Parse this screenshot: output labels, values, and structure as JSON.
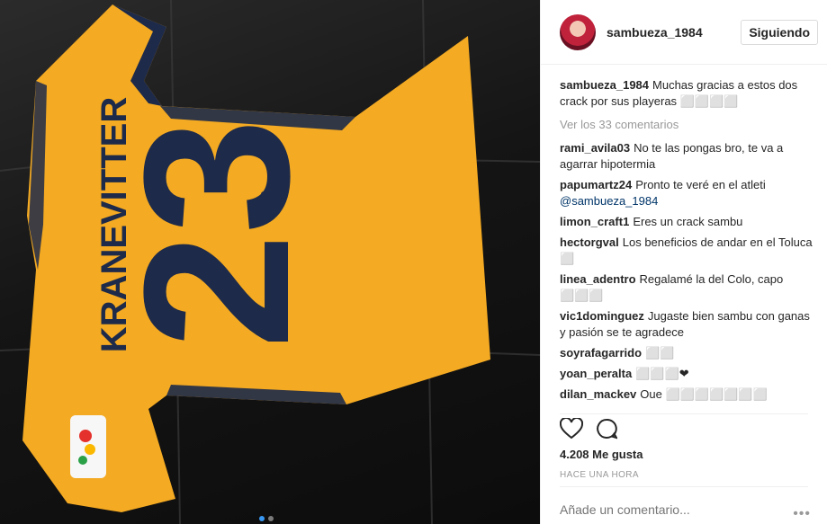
{
  "photo": {
    "jersey_name": "KRANEVITTER",
    "jersey_number": "23",
    "jersey_color": "#f4aa22",
    "trim_color": "#1d2a4a",
    "carousel_dots": 2,
    "carousel_active": 0
  },
  "header": {
    "username": "sambueza_1984",
    "follow_label": "Siguiendo"
  },
  "caption": {
    "user": "sambueza_1984",
    "text": "Muchas gracias a estos dos crack por sus playeras ⬜⬜⬜⬜"
  },
  "view_all_label": "Ver los 33 comentarios",
  "comments": [
    {
      "user": "rami_avila03",
      "text": "No te las pongas bro, te va a agarrar hipotermia"
    },
    {
      "user": "papumartz24",
      "text": "Pronto te veré en el atleti",
      "mention": "@sambueza_1984"
    },
    {
      "user": "limon_craft1",
      "text": "Eres un crack sambu"
    },
    {
      "user": "hectorgval",
      "text": "Los beneficios de andar en el Toluca ⬜"
    },
    {
      "user": "linea_adentro",
      "text": "Regalamé la del Colo, capo ⬜⬜⬜"
    },
    {
      "user": "vic1dominguez",
      "text": "Jugaste bien sambu con ganas y pasión se te agradece"
    },
    {
      "user": "soyrafagarrido",
      "text": "⬜⬜"
    },
    {
      "user": "yoan_peralta",
      "text": "⬜⬜⬜❤"
    },
    {
      "user": "dilan_mackev",
      "text": "Oue ⬜⬜⬜⬜⬜⬜⬜"
    }
  ],
  "likes_label": "4.208 Me gusta",
  "time_label": "HACE UNA HORA",
  "add_comment_placeholder": "Añade un comentario...",
  "more_options": "•••"
}
